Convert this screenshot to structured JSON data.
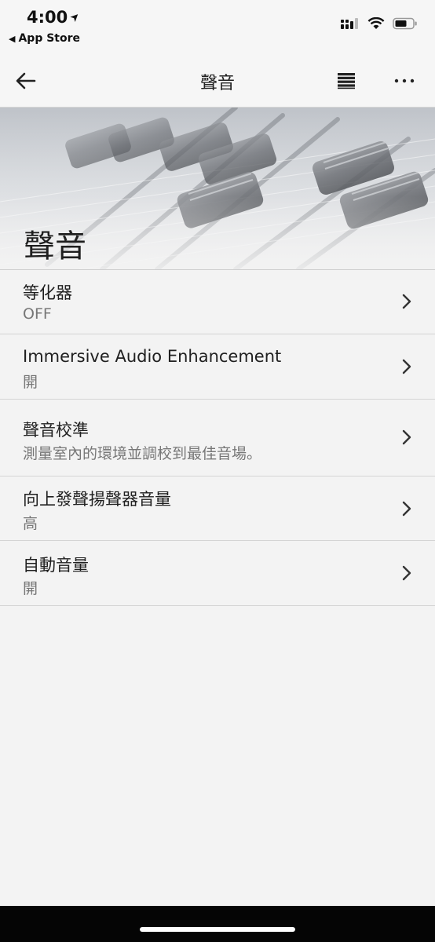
{
  "status_bar": {
    "time": "4:00",
    "back_app": "App Store"
  },
  "nav": {
    "title": "聲音"
  },
  "header": {
    "title": "聲音"
  },
  "rows": [
    {
      "title": "等化器",
      "subtitle": "OFF"
    },
    {
      "title": "Immersive Audio Enhancement",
      "subtitle": "開"
    },
    {
      "title": "聲音校準",
      "subtitle": "測量室內的環境並調校到最佳音場。"
    },
    {
      "title": "向上發聲揚聲器音量",
      "subtitle": "高"
    },
    {
      "title": "自動音量",
      "subtitle": "開"
    }
  ],
  "icons": {
    "location": "location-arrow-icon",
    "signal": "cellular-signal-icon",
    "wifi": "wifi-icon",
    "battery": "battery-icon",
    "back": "back-arrow-icon",
    "list": "list-icon",
    "more": "more-icon",
    "chevron": "chevron-right-icon"
  }
}
